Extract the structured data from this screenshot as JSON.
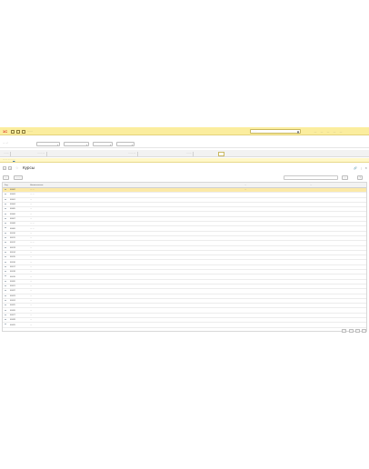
{
  "app": {
    "logo_text": "1С",
    "title": "… …",
    "search_placeholder": "… …",
    "window_buttons": [
      "…",
      "…",
      "…",
      "…",
      "…"
    ]
  },
  "filters": [
    {
      "label": "… …:",
      "value": "…"
    },
    {
      "label": "",
      "value": "…"
    },
    {
      "label": "",
      "value": "…"
    },
    {
      "label": "",
      "value": "…"
    }
  ],
  "tabs": [
    {
      "label": "… …"
    },
    {
      "label": "… … …"
    },
    {
      "label": "… … …"
    },
    {
      "label": "… …"
    },
    {
      "label": "…"
    }
  ],
  "warning": {
    "text": "… … … …",
    "link": "…"
  },
  "page": {
    "title": "Курсы"
  },
  "commands": {
    "create": "…",
    "create_group": "… …",
    "search_placeholder": "…",
    "more": "…",
    "help": "?"
  },
  "grid": {
    "headers": [
      "Код",
      "Наименование",
      "…",
      "…"
    ],
    "rows": [
      {
        "code": "00002",
        "name": "… …",
        "date": "…",
        "selected": true
      },
      {
        "code": "00003",
        "name": "… …"
      },
      {
        "code": "00001",
        "name": "…"
      },
      {
        "code": "00004",
        "name": "…"
      },
      {
        "code": "00005",
        "name": "…"
      },
      {
        "code": "00006",
        "name": "…"
      },
      {
        "code": "00007",
        "name": "…"
      },
      {
        "code": "00008",
        "name": "… …"
      },
      {
        "code": "00009",
        "name": "… …"
      },
      {
        "code": "00010",
        "name": "…"
      },
      {
        "code": "00011",
        "name": "…"
      },
      {
        "code": "00012",
        "name": "… …"
      },
      {
        "code": "00013",
        "name": "…"
      },
      {
        "code": "00014",
        "name": "…"
      },
      {
        "code": "00015",
        "name": "…"
      },
      {
        "code": "00016",
        "name": "…"
      },
      {
        "code": "00017",
        "name": "…"
      },
      {
        "code": "00018",
        "name": "…"
      },
      {
        "code": "00019",
        "name": "…"
      },
      {
        "code": "00020",
        "name": "…"
      },
      {
        "code": "00021",
        "name": "…"
      },
      {
        "code": "00022",
        "name": "…"
      },
      {
        "code": "00023",
        "name": "…"
      },
      {
        "code": "00024",
        "name": "…"
      },
      {
        "code": "00025",
        "name": "…"
      },
      {
        "code": "00026",
        "name": "…"
      },
      {
        "code": "00027",
        "name": "…"
      },
      {
        "code": "00028",
        "name": "…"
      },
      {
        "code": "00029",
        "name": "…"
      }
    ]
  },
  "pager": [
    "…",
    "…",
    "…",
    "…"
  ],
  "colors": {
    "titlebar": "#fbed9e",
    "selected_row": "#fbe9a8",
    "warning_bg": "#fff7c9",
    "logo": "#d92b2b"
  }
}
